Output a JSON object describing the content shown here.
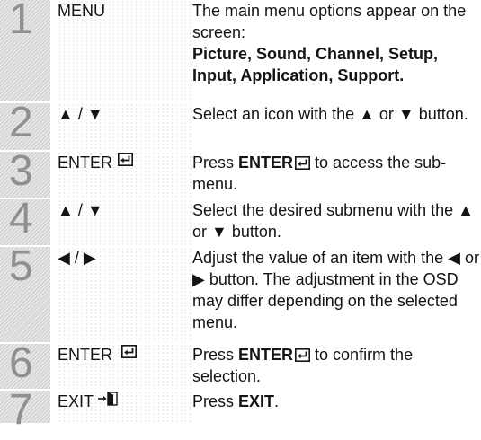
{
  "steps": [
    {
      "number": "1",
      "key": "MENU",
      "desc": "The main menu options appear on the screen:",
      "menu_list": "Picture, Sound, Channel, Setup, Input, Application, Support."
    },
    {
      "number": "2",
      "key": "▲ / ▼",
      "desc": "Select an icon with the ▲ or ▼ button."
    },
    {
      "number": "3",
      "key": "ENTER",
      "key_icon": "enter-icon",
      "desc_before": "Press ",
      "desc_strong": "ENTER",
      "desc_after": " to access the sub-menu."
    },
    {
      "number": "4",
      "key": "▲ / ▼",
      "desc": "Select the desired submenu with the ▲ or ▼ button."
    },
    {
      "number": "5",
      "key": "◀ / ▶",
      "desc": "Adjust the value of an item with the ◀ or ▶ button. The adjustment in the OSD may differ depending on the selected menu."
    },
    {
      "number": "6",
      "key": "ENTER",
      "key_icon": "enter-icon",
      "desc_before": "Press ",
      "desc_strong": "ENTER",
      "desc_after": " to confirm the selection."
    },
    {
      "number": "7",
      "key": "EXIT",
      "key_icon": "exit-icon",
      "desc_before": "Press ",
      "desc_strong": "EXIT",
      "desc_after": "."
    }
  ]
}
